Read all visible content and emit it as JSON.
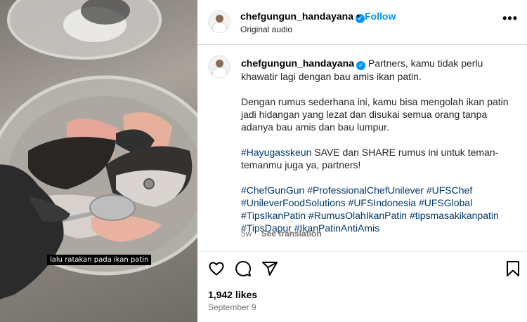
{
  "media": {
    "caption": "lalu ratakan pada ikan patin"
  },
  "header": {
    "username": "chefgungun_handayana",
    "verified_glyph": "✓",
    "separator": "•",
    "follow_label": "Follow",
    "audio": "Original audio",
    "more_glyph": "•••"
  },
  "post": {
    "username": "chefgungun_handayana",
    "verified_glyph": "✓",
    "paragraphs": [
      "Partners, kamu tidak perlu khawatir lagi dengan bau amis ikan patin.",
      "Dengan rumus sederhana ini, kamu bisa mengolah ikan patin jadi hidangan yang lezat dan disukai semua orang tanpa adanya bau amis dan bau lumpur.",
      "SAVE dan SHARE rumus ini untuk teman-temanmu juga ya, partners!"
    ],
    "inline_hashtag": "#Hayugasskeun",
    "hashtags": [
      "#ChefGunGun",
      "#ProfessionalChefUnilever",
      "#UFSChef",
      "#UnileverFoodSolutions",
      "#UFSIndonesia",
      "#UFSGlobal",
      "#TipsIkanPatin",
      "#RumusOlahIkanPatin",
      "#tipsmasakikanpatin",
      "#TipsDapur",
      "#IkanPatinAntiAmis"
    ],
    "age": "5w",
    "see_translation": "See translation"
  },
  "actions": {
    "icons": [
      "heart-icon",
      "comment-icon",
      "share-icon",
      "bookmark-icon"
    ]
  },
  "likes": "1,942 likes",
  "date": "September 9",
  "colors": {
    "link": "#00376b",
    "follow": "#0095f6",
    "muted": "#737373"
  }
}
